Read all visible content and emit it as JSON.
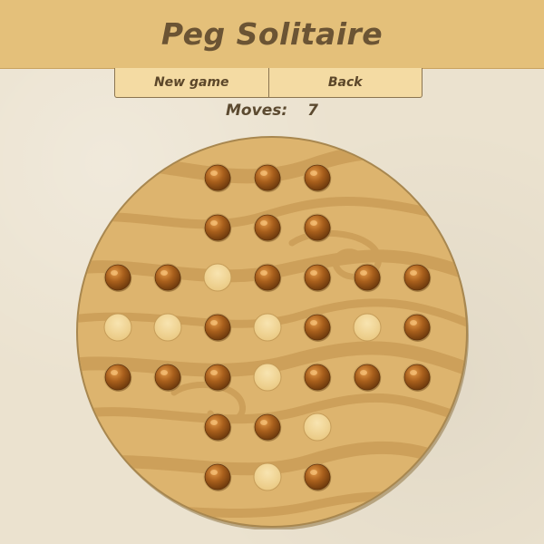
{
  "title": "Peg Solitaire",
  "toolbar": {
    "new_game_label": "New game",
    "back_label": "Back"
  },
  "moves": {
    "label": "Moves:",
    "count": "7"
  },
  "colors": {
    "header": "#e4c07a",
    "board": "#ddb46e",
    "grain": "#cda05a",
    "peg": "#9c5a1a",
    "hole": "#f3d99a"
  },
  "board": {
    "rows": [
      [
        null,
        null,
        1,
        1,
        1,
        null,
        null
      ],
      [
        null,
        null,
        1,
        1,
        1,
        null,
        null
      ],
      [
        1,
        1,
        0,
        1,
        1,
        1,
        1
      ],
      [
        0,
        0,
        1,
        0,
        1,
        0,
        1
      ],
      [
        1,
        1,
        1,
        0,
        1,
        1,
        1
      ],
      [
        null,
        null,
        1,
        1,
        0,
        null,
        null
      ],
      [
        null,
        null,
        1,
        0,
        1,
        null,
        null
      ]
    ]
  }
}
